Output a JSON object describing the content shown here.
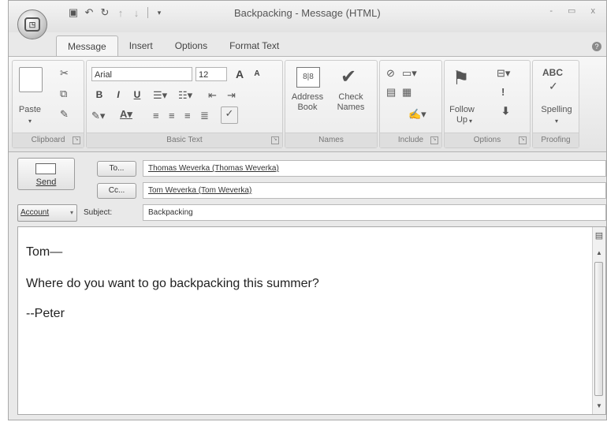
{
  "window": {
    "title": "Backpacking - Message (HTML)",
    "controls": "- ▭ x"
  },
  "quick_access": {
    "save_icon": "save-icon",
    "undo_icon": "undo-icon",
    "redo_icon": "redo-icon"
  },
  "tabs": [
    {
      "label": "Message",
      "active": true
    },
    {
      "label": "Insert"
    },
    {
      "label": "Options"
    },
    {
      "label": "Format Text"
    }
  ],
  "ribbon": {
    "clipboard": {
      "paste": "Paste",
      "group": "Clipboard"
    },
    "basic_text": {
      "font": "Arial",
      "size": "12",
      "bold": "B",
      "italic": "I",
      "underline": "U",
      "group": "Basic Text",
      "grow_font": "A",
      "shrink_font": "A"
    },
    "names": {
      "address_book": "Address Book",
      "check_names": "Check Names",
      "group": "Names"
    },
    "include": {
      "group": "Include"
    },
    "options": {
      "follow_up": "Follow Up",
      "group": "Options"
    },
    "proofing": {
      "spelling": "Spelling",
      "abc": "ABC",
      "group": "Proofing"
    }
  },
  "header": {
    "send": "Send",
    "to_button": "To...",
    "cc_button": "Cc...",
    "to_value": "Thomas Weverka (Thomas Weverka)",
    "cc_value": "Tom Weverka (Tom Weverka)",
    "account": "Account",
    "subject_label": "Subject:",
    "subject_value": "Backpacking"
  },
  "body": {
    "line1": "Tom—",
    "line2": "Where do you want to go backpacking this summer?",
    "line3": "--Peter"
  }
}
